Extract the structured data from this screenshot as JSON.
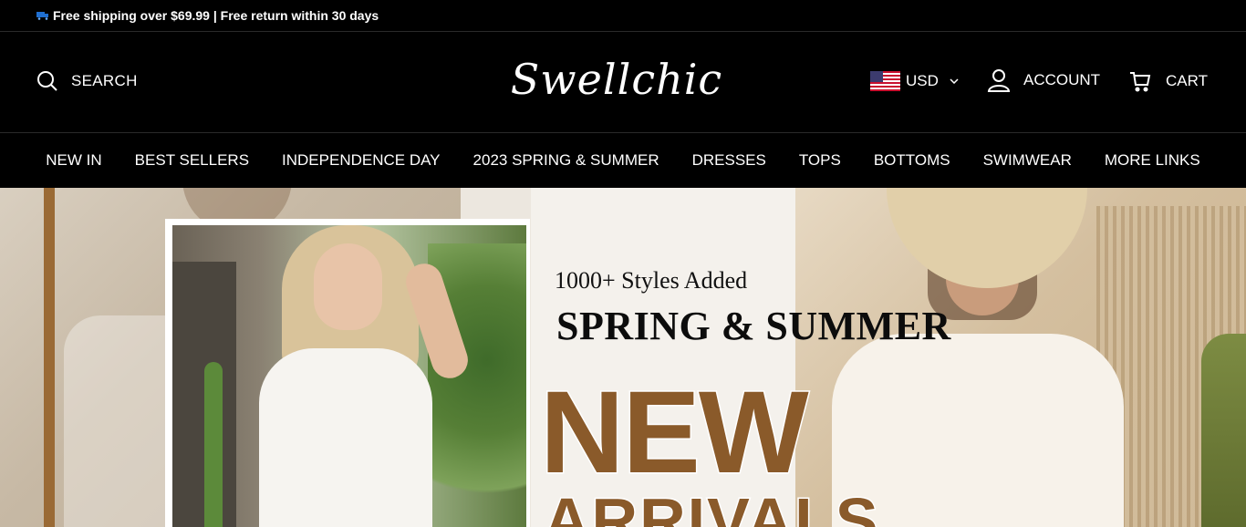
{
  "announcement": {
    "text": "Free shipping over $69.99 | Free return within 30 days",
    "icon": "truck-icon"
  },
  "header": {
    "search_label": "SEARCH",
    "logo_text": "Swellchic",
    "currency": "USD",
    "account_label": "ACCOUNT",
    "cart_label": "CART"
  },
  "nav": {
    "items": [
      {
        "label": "NEW IN"
      },
      {
        "label": "BEST SELLERS"
      },
      {
        "label": "INDEPENDENCE DAY"
      },
      {
        "label": "2023 SPRING & SUMMER"
      },
      {
        "label": "DRESSES"
      },
      {
        "label": "TOPS"
      },
      {
        "label": "BOTTOMS"
      },
      {
        "label": "SWIMWEAR"
      },
      {
        "label": "MORE LINKS"
      }
    ]
  },
  "hero": {
    "subtitle": "1000+ Styles Added",
    "title": "SPRING & SUMMER",
    "headline": "NEW",
    "headline2": "ARRIVALS"
  },
  "colors": {
    "background": "#000000",
    "text": "#ffffff",
    "accent_brown": "#8a5a2a"
  }
}
